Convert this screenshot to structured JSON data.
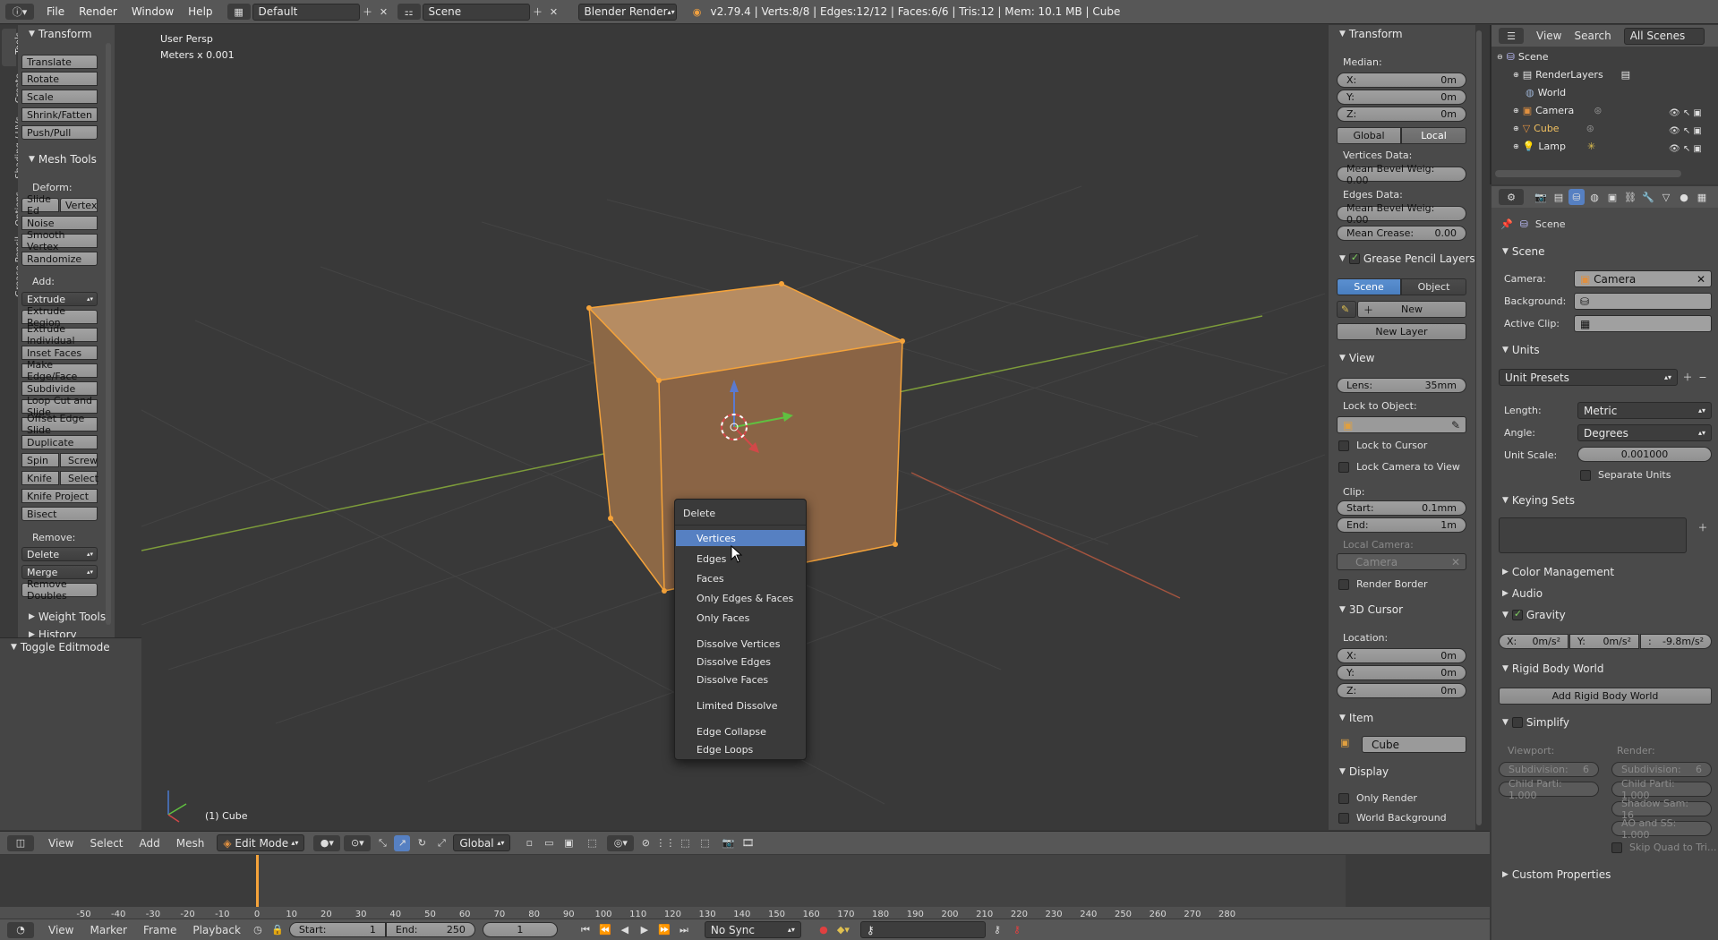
{
  "topbar": {
    "menus": [
      "File",
      "Render",
      "Window",
      "Help"
    ],
    "layout": "Default",
    "scene": "Scene",
    "engine": "Blender Render",
    "stats": "v2.79.4 | Verts:8/8 | Edges:12/12 | Faces:6/6 | Tris:12 | Mem: 10.1 MB | Cube"
  },
  "vtabs": [
    "Tools",
    "Create",
    "Shading / UVs",
    "Options",
    "Grease Pencil"
  ],
  "toolshelf": {
    "transform_header": "Transform",
    "transform": [
      "Translate",
      "Rotate",
      "Scale",
      "Shrink/Fatten",
      "Push/Pull"
    ],
    "mesh_header": "Mesh Tools",
    "deform_label": "Deform:",
    "slide_edge": "Slide Ed",
    "vertex": "Vertex",
    "deform": [
      "Noise",
      "Smooth Vertex",
      "Randomize"
    ],
    "add_label": "Add:",
    "extrude": "Extrude",
    "add": [
      "Extrude Region",
      "Extrude Individual",
      "Inset Faces",
      "Make Edge/Face",
      "Subdivide",
      "Loop Cut and Slide",
      "Offset Edge Slide",
      "Duplicate"
    ],
    "spin": "Spin",
    "screw": "Screw",
    "knife": "Knife",
    "select": "Select",
    "knife_project": "Knife Project",
    "bisect": "Bisect",
    "remove_label": "Remove:",
    "delete": "Delete",
    "merge": "Merge",
    "remove_doubles": "Remove Doubles",
    "weight_tools": "Weight Tools",
    "history": "History",
    "toggle_editmode": "Toggle Editmode"
  },
  "viewport": {
    "view_name": "User Persp",
    "units": "Meters x 0.001",
    "object_label": "(1) Cube"
  },
  "delete_menu": {
    "title": "Delete",
    "items": [
      "Vertices",
      "Edges",
      "Faces",
      "Only Edges & Faces",
      "Only Faces",
      "Dissolve Vertices",
      "Dissolve Edges",
      "Dissolve Faces",
      "Limited Dissolve",
      "Edge Collapse",
      "Edge Loops"
    ]
  },
  "npanel": {
    "transform": "Transform",
    "median": "Median:",
    "x_label": "X:",
    "x_value": "0m",
    "y_label": "Y:",
    "y_value": "0m",
    "z_label": "Z:",
    "z_value": "0m",
    "global": "Global",
    "local": "Local",
    "vertices_data": "Vertices Data:",
    "vert_bevel": "Mean Bevel Weig: 0.00",
    "edges_data": "Edges Data:",
    "edge_bevel": "Mean Bevel Weig: 0.00",
    "edge_crease": "Mean Crease:",
    "edge_crease_value": "0.00",
    "gp_layers": "Grease Pencil Layers",
    "scene_tab": "Scene",
    "object_tab": "Object",
    "new": "New",
    "new_layer": "New Layer",
    "view": "View",
    "lens": "Lens:",
    "lens_value": "35mm",
    "lock_to_object": "Lock to Object:",
    "lock_to_cursor": "Lock to Cursor",
    "lock_camera": "Lock Camera to View",
    "clip": "Clip:",
    "start": "Start:",
    "start_value": "0.1mm",
    "end": "End:",
    "end_value": "1m",
    "local_camera": "Local Camera:",
    "camera": "Camera",
    "render_border": "Render Border",
    "cursor3d": "3D Cursor",
    "location": "Location:",
    "cx": "0m",
    "cy": "0m",
    "cz": "0m",
    "item": "Item",
    "item_name": "Cube",
    "display": "Display",
    "only_render": "Only Render",
    "world_background": "World Background"
  },
  "outliner": {
    "view": "View",
    "search": "Search",
    "filter": "All Scenes",
    "rows": [
      "Scene",
      "RenderLayers",
      "World",
      "Camera",
      "Cube",
      "Lamp"
    ]
  },
  "properties": {
    "breadcrumb": "Scene",
    "scene_header": "Scene",
    "camera_label": "Camera:",
    "camera_value": "Camera",
    "background_label": "Background:",
    "active_clip_label": "Active Clip:",
    "units_header": "Units",
    "unit_presets": "Unit Presets",
    "length_label": "Length:",
    "length_value": "Metric",
    "angle_label": "Angle:",
    "angle_value": "Degrees",
    "unit_scale_label": "Unit Scale:",
    "unit_scale_value": "0.001000",
    "separate_units": "Separate Units",
    "keying_sets": "Keying Sets",
    "color_management": "Color Management",
    "audio": "Audio",
    "gravity": "Gravity",
    "gx": "X:",
    "gx_value": "0m/s²",
    "gy": "Y:",
    "gy_value": "0m/s²",
    "gz": ":",
    "gz_value": "-9.8m/s²",
    "rigid_body_world": "Rigid Body World",
    "add_rigid_body_world": "Add Rigid Body World",
    "simplify": "Simplify",
    "viewport_label": "Viewport:",
    "render_label": "Render:",
    "subdivision_vp": "Subdivision:",
    "subdivision_vp_value": "6",
    "subdivision_r": "Subdivision:",
    "subdivision_r_value": "6",
    "child_vp": "Child Parti: 1.000",
    "child_r": "Child Parti: 1.000",
    "shadow_samples": "Shadow Sam: 16",
    "ao_sss": "AO and SS: 1.000",
    "skip_quad": "Skip Quad to Tri...",
    "custom_properties": "Custom Properties"
  },
  "view3d_header": {
    "menus": [
      "View",
      "Select",
      "Add",
      "Mesh"
    ],
    "mode": "Edit Mode",
    "orientation": "Global"
  },
  "timeline": {
    "ticks": [
      "-50",
      "-40",
      "-30",
      "-20",
      "-10",
      "0",
      "10",
      "20",
      "30",
      "40",
      "50",
      "60",
      "70",
      "80",
      "90",
      "100",
      "110",
      "120",
      "130",
      "140",
      "150",
      "160",
      "170",
      "180",
      "190",
      "200",
      "210",
      "220",
      "230",
      "240",
      "250",
      "260",
      "270",
      "280"
    ],
    "menus": [
      "View",
      "Marker",
      "Frame",
      "Playback"
    ],
    "start_label": "Start:",
    "start_value": "1",
    "end_label": "End:",
    "end_value": "250",
    "current": "1",
    "sync": "No Sync"
  },
  "colors": {
    "selection": "#f5a33a",
    "accent": "#5680c2",
    "header": "#575757"
  }
}
